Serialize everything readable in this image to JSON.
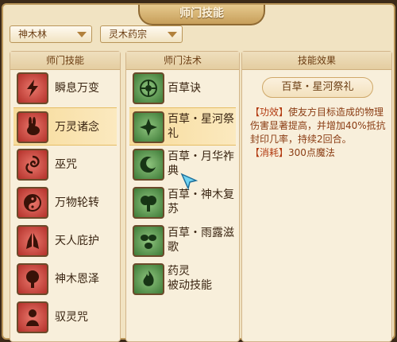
{
  "title": "师门技能",
  "dropdowns": {
    "sect": "神木林",
    "school": "灵木药宗"
  },
  "skills_panel": {
    "header": "师门技能",
    "items": [
      {
        "label": "瞬息万变",
        "icon": "lightning-icon"
      },
      {
        "label": "万灵诸念",
        "icon": "spirit-rabbit-icon",
        "selected": true
      },
      {
        "label": "巫咒",
        "icon": "curse-swirl-icon"
      },
      {
        "label": "万物轮转",
        "icon": "yin-yang-icon"
      },
      {
        "label": "天人庇护",
        "icon": "praying-hands-icon"
      },
      {
        "label": "神木恩泽",
        "icon": "sacred-tree-icon"
      },
      {
        "label": "驭灵咒",
        "icon": "hooded-figure-icon"
      }
    ]
  },
  "spells_panel": {
    "header": "师门法术",
    "items": [
      {
        "line1": "百草诀",
        "line2": "",
        "icon": "herb-wheel-icon"
      },
      {
        "line1": "百草・星河祭",
        "line2": "礼",
        "icon": "star-leaf-icon",
        "selected": true
      },
      {
        "line1": "百草・月华祚",
        "line2": "典",
        "icon": "moon-swirl-icon"
      },
      {
        "line1": "百草・神木复",
        "line2": "苏",
        "icon": "tree-revive-icon"
      },
      {
        "line1": "百草・雨露滋",
        "line2": "歌",
        "icon": "dew-leaves-icon"
      },
      {
        "line1": "药灵",
        "line2": "被动技能",
        "icon": "flame-spirit-icon"
      }
    ]
  },
  "effect_panel": {
    "header": "技能效果",
    "name": "百草・星河祭礼",
    "effect_tag": "【功效】",
    "effect_text": "使友方目标造成的物理伤害显著提高，并增加40%抵抗封印几率，持续2回合。",
    "cost_tag": "【消耗】",
    "cost_text": "300点魔法"
  },
  "colors": {
    "selected_row": "#f7db9a",
    "accent_text": "#8a3c13",
    "frame_border": "#b99558"
  }
}
